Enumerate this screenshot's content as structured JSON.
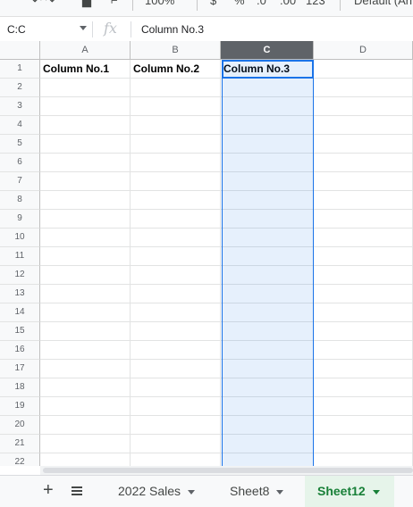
{
  "toolbar": {
    "zoom": "100%",
    "currency": "$",
    "percent": "%",
    "decrease_decimal": ".0",
    "increase_decimal": ".00",
    "more_formats": "123",
    "font": "Default (Ari..."
  },
  "formula_bar": {
    "name_box": "C:C",
    "fx": "fx",
    "content": "Column No.3"
  },
  "columns": [
    "A",
    "B",
    "C",
    "D"
  ],
  "selected_column": "C",
  "rows": [
    "1",
    "2",
    "3",
    "4",
    "5",
    "6",
    "7",
    "8",
    "9",
    "10",
    "11",
    "12",
    "13",
    "14",
    "15",
    "16",
    "17",
    "18",
    "19",
    "20",
    "21",
    "22"
  ],
  "cells": {
    "A1": "Column No.1",
    "B1": "Column No.2",
    "C1": "Column No.3"
  },
  "sheet_tabs": [
    {
      "label": "2022 Sales",
      "active": false
    },
    {
      "label": "Sheet8",
      "active": false
    },
    {
      "label": "Sheet12",
      "active": true
    }
  ],
  "colors": {
    "accent": "#1a73e8",
    "active_tab": "#188038",
    "active_tab_bg": "#e6f4ea"
  }
}
